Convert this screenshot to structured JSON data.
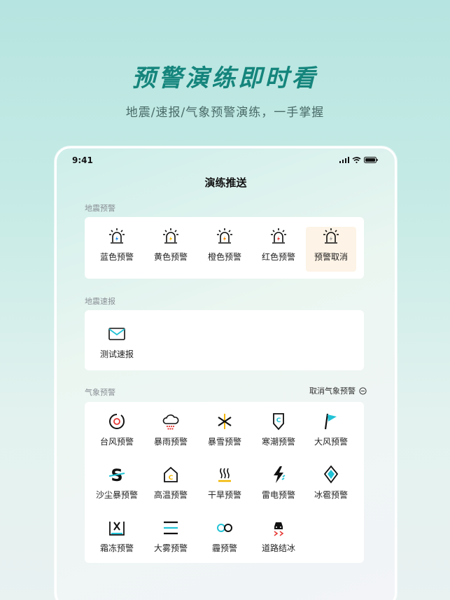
{
  "hero": {
    "title": "预警演练即时看",
    "subtitle": "地震/速报/气象预警演练，一手掌握"
  },
  "status_bar": {
    "time": "9:41"
  },
  "nav": {
    "title": "演练推送"
  },
  "sections": {
    "earthquake_warning": {
      "label": "地震预警",
      "items": [
        {
          "label": "蓝色预警",
          "icon": "blue-alarm-icon",
          "color": "#1e88e5"
        },
        {
          "label": "黄色预警",
          "icon": "yellow-alarm-icon",
          "color": "#f2b600"
        },
        {
          "label": "橙色预警",
          "icon": "orange-alarm-icon",
          "color": "#ff8a00"
        },
        {
          "label": "红色预警",
          "icon": "red-alarm-icon",
          "color": "#e53935"
        },
        {
          "label": "预警取消",
          "icon": "cancel-alarm-icon",
          "color": "#9e9e9e"
        }
      ]
    },
    "earthquake_report": {
      "label": "地震速报",
      "items": [
        {
          "label": "测试速报",
          "icon": "envelope-icon"
        }
      ]
    },
    "weather_warning": {
      "label": "气象预警",
      "cancel_label": "取消气象预警",
      "items": [
        {
          "label": "台风预警",
          "icon": "typhoon-icon"
        },
        {
          "label": "暴雨预警",
          "icon": "rainstorm-icon"
        },
        {
          "label": "暴雪预警",
          "icon": "snowstorm-icon"
        },
        {
          "label": "寒潮预警",
          "icon": "cold-wave-icon"
        },
        {
          "label": "大风预警",
          "icon": "gale-icon"
        },
        {
          "label": "沙尘暴预警",
          "icon": "sandstorm-icon"
        },
        {
          "label": "高温预警",
          "icon": "heat-icon"
        },
        {
          "label": "干旱预警",
          "icon": "drought-icon"
        },
        {
          "label": "雷电预警",
          "icon": "lightning-icon"
        },
        {
          "label": "冰雹预警",
          "icon": "hail-icon"
        },
        {
          "label": "霜冻预警",
          "icon": "frost-icon"
        },
        {
          "label": "大雾预警",
          "icon": "fog-icon"
        },
        {
          "label": "霾预警",
          "icon": "haze-icon"
        },
        {
          "label": "道路结冰",
          "icon": "road-icing-icon"
        }
      ]
    }
  },
  "colors": {
    "accent": "#15857c",
    "cyan": "#22c3d6",
    "yellow": "#f2b600"
  }
}
